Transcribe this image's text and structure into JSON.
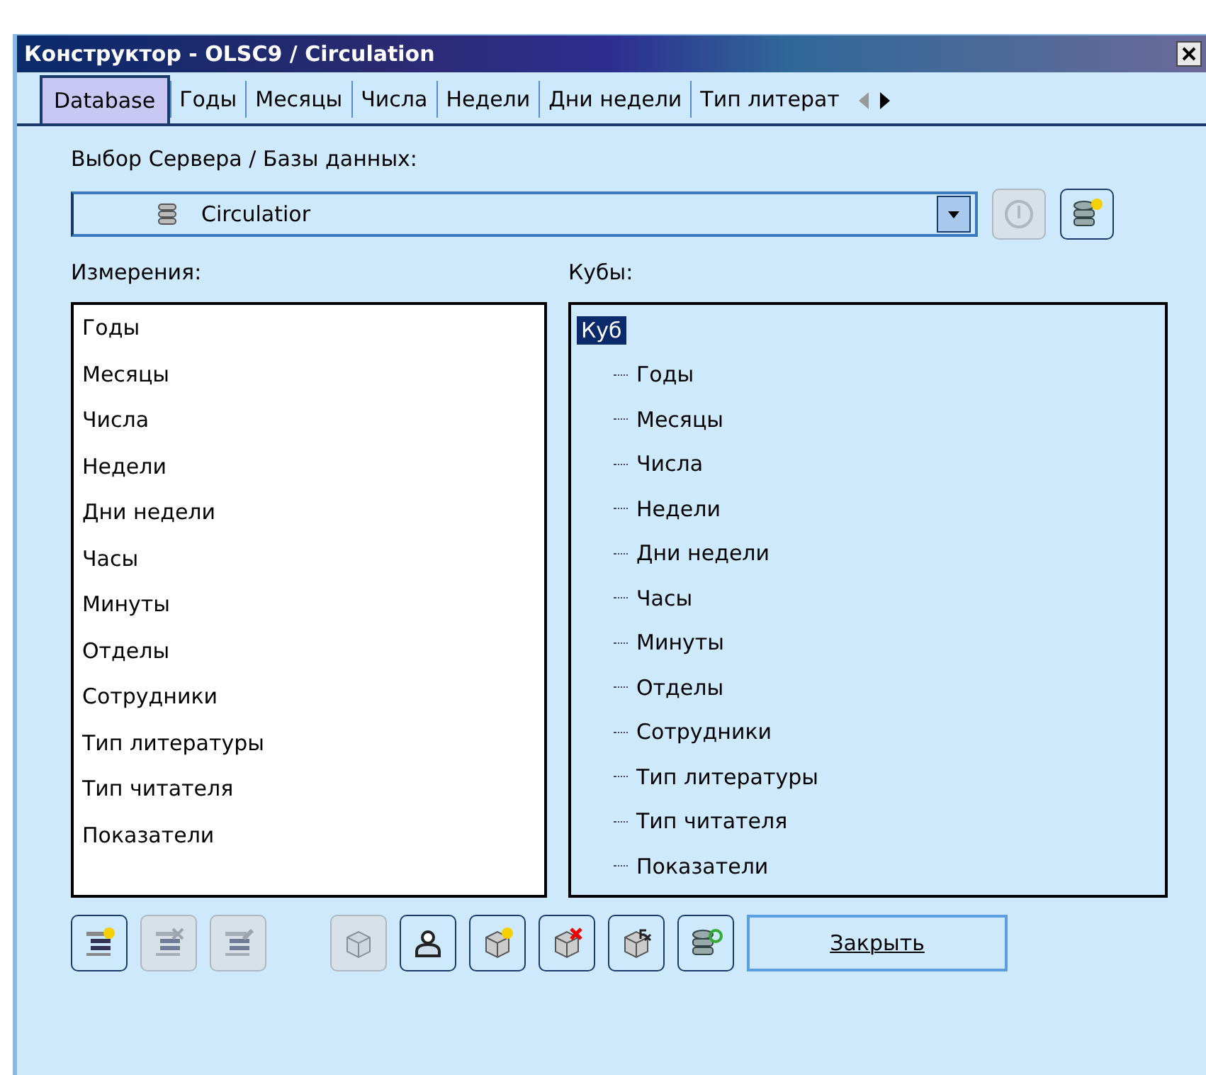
{
  "window": {
    "title": "Конструктор - OLSC9 / Circulation"
  },
  "tabs": [
    {
      "label": "Database",
      "selected": true
    },
    {
      "label": "Годы",
      "selected": false
    },
    {
      "label": "Месяцы",
      "selected": false
    },
    {
      "label": "Числа",
      "selected": false
    },
    {
      "label": "Недели",
      "selected": false
    },
    {
      "label": "Дни недели",
      "selected": false
    },
    {
      "label": "Тип литерат",
      "selected": false
    }
  ],
  "server_label": "Выбор Сервера / Базы данных:",
  "database_combo": {
    "value": "Circulatior"
  },
  "server_buttons": [
    {
      "kind": "info",
      "disabled": true
    },
    {
      "kind": "new-database",
      "disabled": false
    }
  ],
  "dimensions": {
    "label": "Измерения:",
    "items": [
      "Годы",
      "Месяцы",
      "Числа",
      "Недели",
      "Дни недели",
      "Часы",
      "Минуты",
      "Отделы",
      "Сотрудники",
      "Тип литературы",
      "Тип читателя",
      "Показатели"
    ]
  },
  "cubes": {
    "label": "Кубы:",
    "tree": [
      {
        "label": "Куб",
        "selected": true,
        "children": [
          {
            "label": "Годы",
            "selected": false
          },
          {
            "label": "Месяцы",
            "selected": false
          },
          {
            "label": "Числа",
            "selected": false
          },
          {
            "label": "Недели",
            "selected": false
          },
          {
            "label": "Дни недели",
            "selected": false
          },
          {
            "label": "Часы",
            "selected": false
          },
          {
            "label": "Минуты",
            "selected": false
          },
          {
            "label": "Отделы",
            "selected": false
          },
          {
            "label": "Сотрудники",
            "selected": false
          },
          {
            "label": "Тип литературы",
            "selected": false
          },
          {
            "label": "Тип читателя",
            "selected": false
          },
          {
            "label": "Показатели",
            "selected": false
          }
        ]
      }
    ]
  },
  "toolbar": [
    {
      "kind": "list-add",
      "disabled": false
    },
    {
      "kind": "list-delete",
      "disabled": true
    },
    {
      "kind": "list-edit",
      "disabled": true
    },
    {
      "kind": "cube",
      "disabled": true
    },
    {
      "kind": "user",
      "disabled": false
    },
    {
      "kind": "cube-add",
      "disabled": false
    },
    {
      "kind": "cube-delete",
      "disabled": false
    },
    {
      "kind": "cube-formula",
      "disabled": false
    },
    {
      "kind": "database-settings",
      "disabled": false
    }
  ],
  "close_button": {
    "label": "Закрыть"
  }
}
